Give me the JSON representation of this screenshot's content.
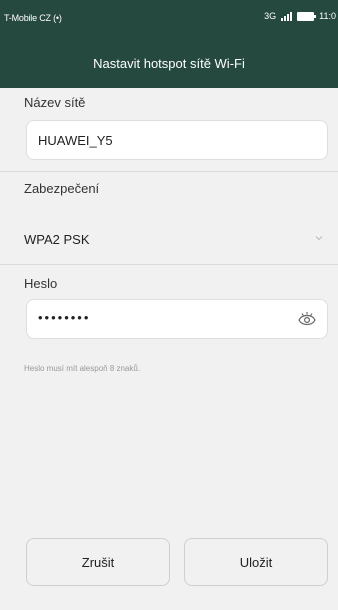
{
  "statusbar": {
    "carrier": "T-Mobile CZ (•)",
    "network": "3G",
    "time": "11:0"
  },
  "header": {
    "title": "Nastavit hotspot sítě Wi-Fi"
  },
  "form": {
    "network_name_label": "Název sítě",
    "network_name_value": "HUAWEI_Y5",
    "security_label": "Zabezpečení",
    "security_value": "WPA2 PSK",
    "password_label": "Heslo",
    "password_value": "••••••••",
    "password_hint": "Heslo musí mít alespoň 8 znaků."
  },
  "buttons": {
    "cancel": "Zrušit",
    "save": "Uložit"
  },
  "icons": {
    "signal": "signal-bars-icon",
    "battery": "battery-icon",
    "dropdown": "chevron-down-icon",
    "show_password": "eye-icon"
  },
  "colors": {
    "header_bg": "#25483f",
    "background": "#f1f1f1"
  }
}
